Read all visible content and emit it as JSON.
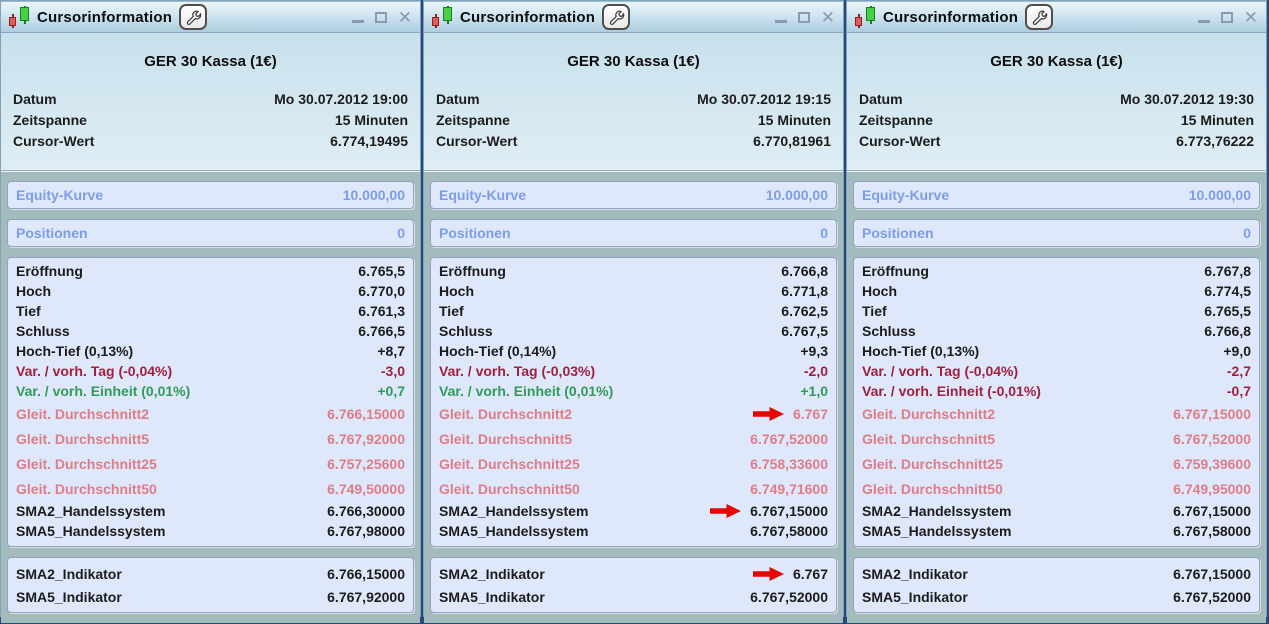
{
  "colors": {
    "text": "#1b1b1b",
    "loss": "#a01f3d",
    "gain": "#2f9b57",
    "ma": "#de7c87",
    "link": "#7d9de6",
    "arrow": "#e60505",
    "candle_red": "#e05c5c",
    "candle_green": "#46d146"
  },
  "icons": {
    "titlebar_icon": "candlestick-pair",
    "settings_icon": "wrench",
    "close_glyph": "✕"
  },
  "panels": [
    {
      "title": "Cursorinformation",
      "instrument": "GER 30 Kassa (1€)",
      "info_rows": [
        {
          "label": "Datum",
          "value": "Mo 30.07.2012 19:00"
        },
        {
          "label": "Zeitspanne",
          "value": "15 Minuten"
        },
        {
          "label": "Cursor-Wert",
          "value": "6.774,19495"
        }
      ],
      "equity_row": {
        "label": "Equity-Kurve",
        "value": "10.000,00"
      },
      "positions_row": {
        "label": "Positionen",
        "value": "0"
      },
      "price_rows": [
        {
          "label": "Eröffnung",
          "value": "6.765,5",
          "color": "text"
        },
        {
          "label": "Hoch",
          "value": "6.770,0",
          "color": "text"
        },
        {
          "label": "Tief",
          "value": "6.761,3",
          "color": "text"
        },
        {
          "label": "Schluss",
          "value": "6.766,5",
          "color": "text"
        },
        {
          "label": "Hoch-Tief (0,13%)",
          "value": "+8,7",
          "color": "text"
        },
        {
          "label": "Var. / vorh. Tag (-0,04%)",
          "value": "-3,0",
          "color": "loss"
        },
        {
          "label": "Var. / vorh. Einheit (0,01%)",
          "value": "+0,7",
          "color": "gain"
        },
        {
          "label": "Gleit. Durchschnitt2",
          "value": "6.766,15000",
          "color": "ma"
        },
        {
          "label": "Gleit. Durchschnitt5",
          "value": "6.767,92000",
          "color": "ma"
        },
        {
          "label": "Gleit. Durchschnitt25",
          "value": "6.757,25600",
          "color": "ma"
        },
        {
          "label": "Gleit. Durchschnitt50",
          "value": "6.749,50000",
          "color": "ma"
        },
        {
          "label": "SMA2_Handelssystem",
          "value": "6.766,30000",
          "color": "text"
        },
        {
          "label": "SMA5_Handelssystem",
          "value": "6.767,98000",
          "color": "text"
        }
      ],
      "indicator_rows": [
        {
          "label": "SMA2_Indikator",
          "value": "6.766,15000",
          "color": "text"
        },
        {
          "label": "SMA5_Indikator",
          "value": "6.767,92000",
          "color": "text"
        }
      ]
    },
    {
      "title": "Cursorinformation",
      "instrument": "GER 30 Kassa (1€)",
      "info_rows": [
        {
          "label": "Datum",
          "value": "Mo 30.07.2012 19:15"
        },
        {
          "label": "Zeitspanne",
          "value": "15 Minuten"
        },
        {
          "label": "Cursor-Wert",
          "value": "6.770,81961"
        }
      ],
      "equity_row": {
        "label": "Equity-Kurve",
        "value": "10.000,00"
      },
      "positions_row": {
        "label": "Positionen",
        "value": "0"
      },
      "price_rows": [
        {
          "label": "Eröffnung",
          "value": "6.766,8",
          "color": "text"
        },
        {
          "label": "Hoch",
          "value": "6.771,8",
          "color": "text"
        },
        {
          "label": "Tief",
          "value": "6.762,5",
          "color": "text"
        },
        {
          "label": "Schluss",
          "value": "6.767,5",
          "color": "text"
        },
        {
          "label": "Hoch-Tief (0,14%)",
          "value": "+9,3",
          "color": "text"
        },
        {
          "label": "Var. / vorh. Tag (-0,03%)",
          "value": "-2,0",
          "color": "loss"
        },
        {
          "label": "Var. / vorh. Einheit (0,01%)",
          "value": "+1,0",
          "color": "gain"
        },
        {
          "label": "Gleit. Durchschnitt2",
          "value": "6.767",
          "color": "ma",
          "arrow": true
        },
        {
          "label": "Gleit. Durchschnitt5",
          "value": "6.767,52000",
          "color": "ma"
        },
        {
          "label": "Gleit. Durchschnitt25",
          "value": "6.758,33600",
          "color": "ma"
        },
        {
          "label": "Gleit. Durchschnitt50",
          "value": "6.749,71600",
          "color": "ma"
        },
        {
          "label": "SMA2_Handelssystem",
          "value": "6.767,15000",
          "color": "text",
          "arrow": true
        },
        {
          "label": "SMA5_Handelssystem",
          "value": "6.767,58000",
          "color": "text"
        }
      ],
      "indicator_rows": [
        {
          "label": "SMA2_Indikator",
          "value": "6.767",
          "color": "text",
          "arrow": true
        },
        {
          "label": "SMA5_Indikator",
          "value": "6.767,52000",
          "color": "text"
        }
      ]
    },
    {
      "title": "Cursorinformation",
      "instrument": "GER 30 Kassa (1€)",
      "info_rows": [
        {
          "label": "Datum",
          "value": "Mo 30.07.2012 19:30"
        },
        {
          "label": "Zeitspanne",
          "value": "15 Minuten"
        },
        {
          "label": "Cursor-Wert",
          "value": "6.773,76222"
        }
      ],
      "equity_row": {
        "label": "Equity-Kurve",
        "value": "10.000,00"
      },
      "positions_row": {
        "label": "Positionen",
        "value": "0"
      },
      "price_rows": [
        {
          "label": "Eröffnung",
          "value": "6.767,8",
          "color": "text"
        },
        {
          "label": "Hoch",
          "value": "6.774,5",
          "color": "text"
        },
        {
          "label": "Tief",
          "value": "6.765,5",
          "color": "text"
        },
        {
          "label": "Schluss",
          "value": "6.766,8",
          "color": "text"
        },
        {
          "label": "Hoch-Tief (0,13%)",
          "value": "+9,0",
          "color": "text"
        },
        {
          "label": "Var. / vorh. Tag (-0,04%)",
          "value": "-2,7",
          "color": "loss"
        },
        {
          "label": "Var. / vorh. Einheit (-0,01%)",
          "value": "-0,7",
          "color": "loss"
        },
        {
          "label": "Gleit. Durchschnitt2",
          "value": "6.767,15000",
          "color": "ma"
        },
        {
          "label": "Gleit. Durchschnitt5",
          "value": "6.767,52000",
          "color": "ma"
        },
        {
          "label": "Gleit. Durchschnitt25",
          "value": "6.759,39600",
          "color": "ma"
        },
        {
          "label": "Gleit. Durchschnitt50",
          "value": "6.749,95000",
          "color": "ma"
        },
        {
          "label": "SMA2_Handelssystem",
          "value": "6.767,15000",
          "color": "text"
        },
        {
          "label": "SMA5_Handelssystem",
          "value": "6.767,58000",
          "color": "text"
        }
      ],
      "indicator_rows": [
        {
          "label": "SMA2_Indikator",
          "value": "6.767,15000",
          "color": "text"
        },
        {
          "label": "SMA5_Indikator",
          "value": "6.767,52000",
          "color": "text"
        }
      ]
    }
  ]
}
